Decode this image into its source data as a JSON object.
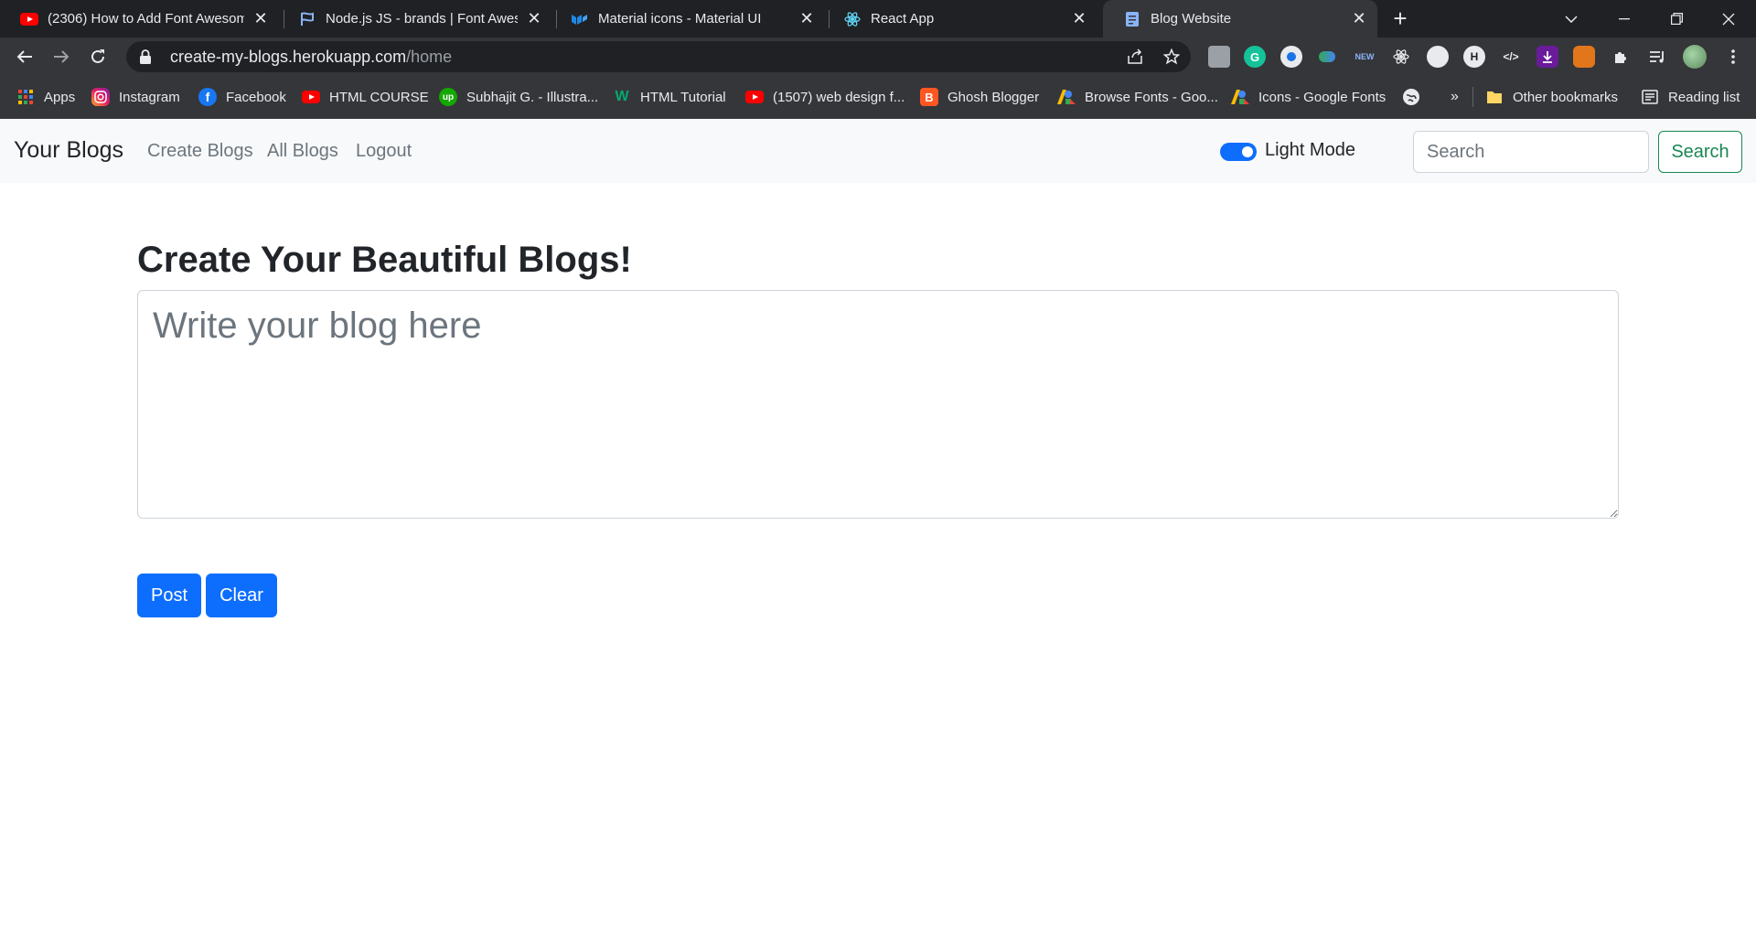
{
  "browser": {
    "tabs": [
      {
        "title": "(2306) How to Add Font Awesome",
        "icon": "youtube-icon"
      },
      {
        "title": "Node.js JS - brands | Font Awesome",
        "icon": "font-awesome-flag-icon"
      },
      {
        "title": "Material icons - Material UI",
        "icon": "material-ui-icon"
      },
      {
        "title": "React App",
        "icon": "react-icon"
      },
      {
        "title": "Blog Website",
        "icon": "page-icon",
        "active": true
      }
    ],
    "url_host": "create-my-blogs.herokuapp.com",
    "url_path": "/home",
    "bookmarks": [
      {
        "label": "Apps",
        "icon": "apps-grid-icon"
      },
      {
        "label": "Instagram",
        "icon": "instagram-icon"
      },
      {
        "label": "Facebook",
        "icon": "facebook-icon"
      },
      {
        "label": "HTML COURSE",
        "icon": "youtube-icon"
      },
      {
        "label": "Subhajit G. - Illustra...",
        "icon": "upwork-icon"
      },
      {
        "label": "HTML Tutorial",
        "icon": "w3schools-icon"
      },
      {
        "label": "(1507) web design f...",
        "icon": "youtube-icon"
      },
      {
        "label": "Ghosh Blogger",
        "icon": "blogger-icon"
      },
      {
        "label": "Browse Fonts - Goo...",
        "icon": "google-fonts-icon"
      },
      {
        "label": "Icons - Google Fonts",
        "icon": "google-fonts-icon"
      }
    ],
    "overflow_label": "»",
    "other_bookmarks": "Other bookmarks",
    "reading_list": "Reading list"
  },
  "navbar": {
    "brand": "Your Blogs",
    "links": [
      "Create Blogs",
      "All Blogs",
      "Logout"
    ],
    "mode_label": "Light Mode",
    "search_placeholder": "Search",
    "search_button": "Search"
  },
  "main": {
    "title": "Create Your Beautiful Blogs!",
    "textarea_placeholder": "Write your blog here",
    "post_button": "Post",
    "clear_button": "Clear"
  },
  "colors": {
    "primary": "#0d6efd",
    "success": "#198754",
    "navbar_bg": "#f8f9fa",
    "chrome_dark": "#202124",
    "chrome_toolbar": "#35363a"
  }
}
